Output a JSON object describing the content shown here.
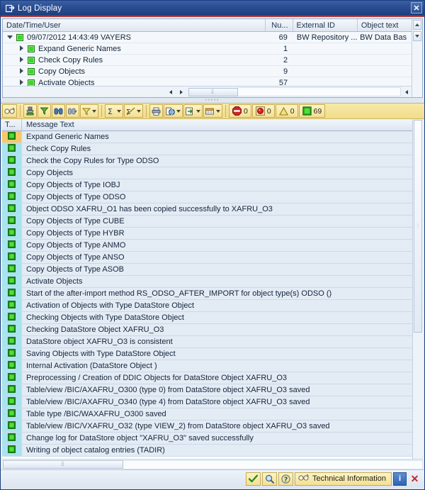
{
  "window": {
    "title": "Log Display",
    "title_icon": "log-window-icon",
    "close_label": "✕"
  },
  "tree": {
    "columns": [
      {
        "label": "Date/Time/User",
        "name": "date-time-user"
      },
      {
        "label": "Nu...",
        "name": "number"
      },
      {
        "label": "External ID",
        "name": "external-id"
      },
      {
        "label": "Object text",
        "name": "object-text"
      }
    ],
    "rows": [
      {
        "label": "09/07/2012  14:43:49  VAYERS",
        "num": "69",
        "ext": "BW Repository ...",
        "obj": "BW Data Bas",
        "level": 0,
        "expanded": true
      },
      {
        "label": "Expand Generic Names",
        "num": "1",
        "ext": "",
        "obj": "",
        "level": 1,
        "expanded": false
      },
      {
        "label": "Check Copy Rules",
        "num": "2",
        "ext": "",
        "obj": "",
        "level": 1,
        "expanded": false
      },
      {
        "label": "Copy Objects",
        "num": "9",
        "ext": "",
        "obj": "",
        "level": 1,
        "expanded": false
      },
      {
        "label": "Activate Objects",
        "num": "57",
        "ext": "",
        "obj": "",
        "level": 1,
        "expanded": false
      }
    ]
  },
  "toolbar": {
    "buttons": [
      {
        "name": "technical-information-glasses-icon",
        "glyph": "glasses",
        "dropdown": false,
        "sep_after": true
      },
      {
        "name": "print-preview-icon",
        "glyph": "print-stamp",
        "dropdown": false,
        "sep_after": false
      },
      {
        "name": "filter-highlight-icon",
        "glyph": "funnel-green",
        "dropdown": false,
        "sep_after": false
      },
      {
        "name": "find-icon",
        "glyph": "binoculars",
        "dropdown": false,
        "sep_after": false
      },
      {
        "name": "find-next-icon",
        "glyph": "binoculars-plus",
        "dropdown": false,
        "sep_after": false
      },
      {
        "name": "filter-icon",
        "glyph": "funnel",
        "dropdown": true,
        "sep_after": true
      },
      {
        "name": "total-icon",
        "glyph": "sigma",
        "dropdown": true,
        "sep_after": false
      },
      {
        "name": "subtotal-icon",
        "glyph": "sigma-slash",
        "dropdown": true,
        "sep_after": true
      },
      {
        "name": "print-icon",
        "glyph": "printer",
        "dropdown": false,
        "sep_after": false
      },
      {
        "name": "view-icon",
        "glyph": "globe-doc",
        "dropdown": true,
        "sep_after": false
      },
      {
        "name": "export-icon",
        "glyph": "export-arrow",
        "dropdown": true,
        "sep_after": false
      },
      {
        "name": "layout-icon",
        "glyph": "grid-table",
        "dropdown": true,
        "sep_after": true
      }
    ],
    "counters": [
      {
        "name": "abort-count",
        "glyph": "stop-sign-icon",
        "value": "0"
      },
      {
        "name": "error-count",
        "glyph": "red-dot-icon",
        "value": "0"
      },
      {
        "name": "warning-count",
        "glyph": "warning-triangle-icon",
        "value": "0"
      },
      {
        "name": "success-count",
        "glyph": "green-square-icon",
        "value": "69"
      }
    ]
  },
  "grid": {
    "columns": [
      {
        "label": "T...",
        "name": "type"
      },
      {
        "label": "Message Text",
        "name": "message-text"
      }
    ],
    "rows": [
      {
        "text": "Expand Generic Names",
        "selected": true
      },
      {
        "text": "Check Copy Rules",
        "selected": false
      },
      {
        "text": "Check the Copy Rules for Type ODSO",
        "selected": false
      },
      {
        "text": "Copy Objects",
        "selected": false
      },
      {
        "text": "Copy Objects of Type IOBJ",
        "selected": false
      },
      {
        "text": "Copy Objects of Type ODSO",
        "selected": false
      },
      {
        "text": "Object ODSO XAFRU_O1 has been copied successfully to XAFRU_O3",
        "selected": false
      },
      {
        "text": "Copy Objects of Type CUBE",
        "selected": false
      },
      {
        "text": "Copy Objects of Type HYBR",
        "selected": false
      },
      {
        "text": "Copy Objects of Type ANMO",
        "selected": false
      },
      {
        "text": "Copy Objects of Type ANSO",
        "selected": false
      },
      {
        "text": "Copy Objects of Type ASOB",
        "selected": false
      },
      {
        "text": "Activate Objects",
        "selected": false
      },
      {
        "text": "Start of the after-import method RS_ODSO_AFTER_IMPORT for object type(s) ODSO ()",
        "selected": false
      },
      {
        "text": "Activation of Objects with Type DataStore Object",
        "selected": false
      },
      {
        "text": "Checking Objects with Type DataStore Object",
        "selected": false
      },
      {
        "text": "Checking DataStore Object XAFRU_O3",
        "selected": false
      },
      {
        "text": "DataStore object XAFRU_O3 is consistent",
        "selected": false
      },
      {
        "text": "Saving Objects with Type DataStore Object",
        "selected": false
      },
      {
        "text": "Internal Activation (DataStore Object )",
        "selected": false
      },
      {
        "text": "Preprocessing / Creation of DDIC Objects for DataStore Object XAFRU_O3",
        "selected": false
      },
      {
        "text": "Table/view /BIC/AXAFRU_O300 (type 0) from DataStore object XAFRU_O3 saved",
        "selected": false
      },
      {
        "text": "Table/view /BIC/AXAFRU_O340 (type 4) from DataStore object XAFRU_O3 saved",
        "selected": false
      },
      {
        "text": "Table type /BIC/WAXAFRU_O300 saved",
        "selected": false
      },
      {
        "text": "Table/view /BIC/VXAFRU_O32 (type VIEW_2) from DataStore object XAFRU_O3 saved",
        "selected": false
      },
      {
        "text": "Change log for DataStore object \"XAFRU_O3\" saved successfully",
        "selected": false
      },
      {
        "text": "Writing of object catalog entries (TADIR)",
        "selected": false
      }
    ]
  },
  "statusbar": {
    "continue_icon": "green-check-icon",
    "search_icon": "magnifier-icon",
    "help_icon": "question-help-icon",
    "tech_info_icon": "glasses-icon",
    "tech_info_label": "Technical Information",
    "info_label": "i",
    "cancel_label": "✕"
  },
  "colors": {
    "title_bar": "#2b4e92",
    "toolbar": "#f0dc8a",
    "row_type_cell": "#a8e4ef",
    "row_selected_cell": "#f4c96a",
    "row_text_cell": "#e3ebf4",
    "status_green": "#39d52a"
  }
}
